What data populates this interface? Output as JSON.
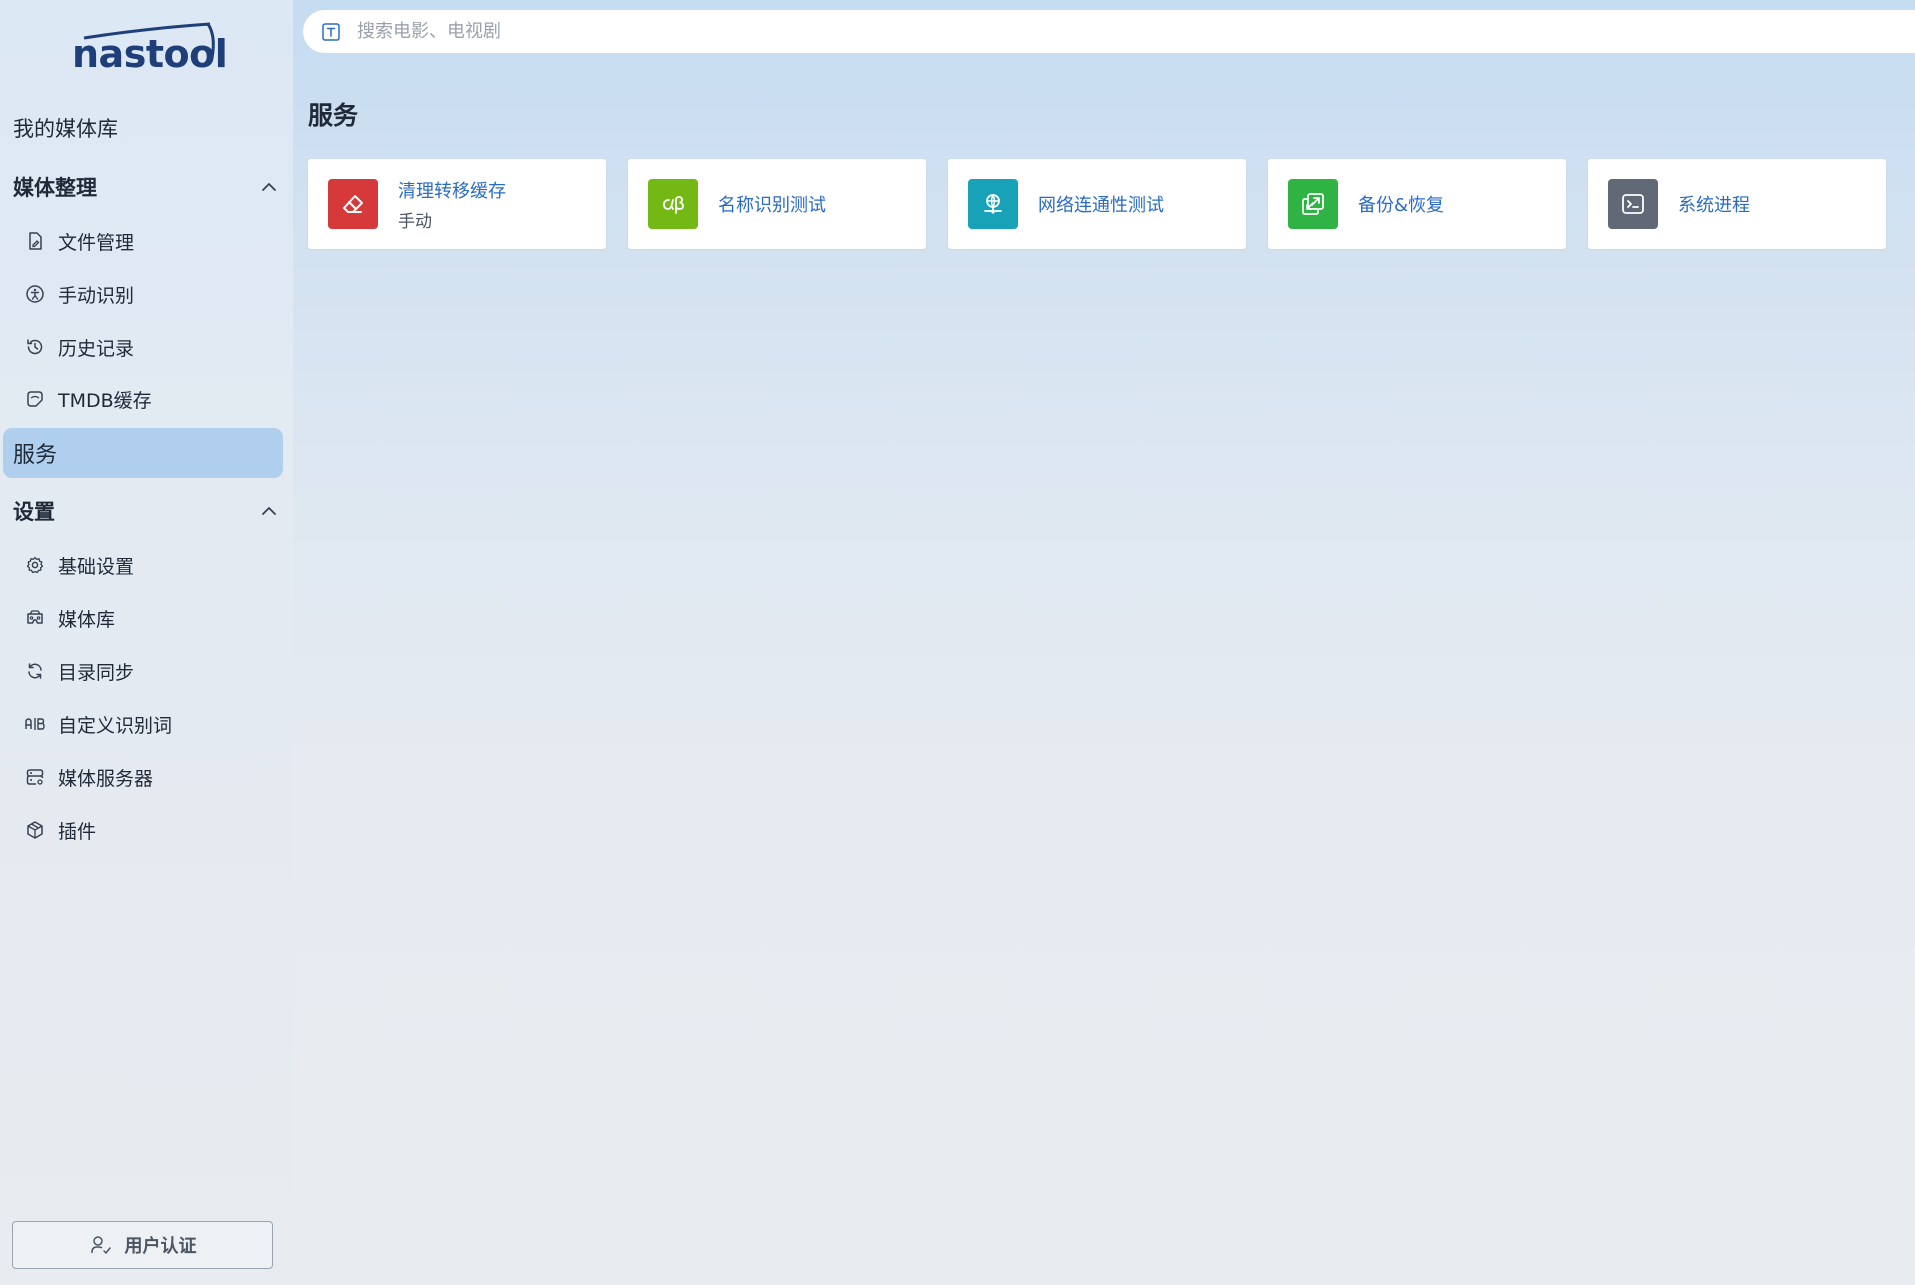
{
  "app": {
    "logo_text": "nastool"
  },
  "sidebar": {
    "top_item": "我的媒体库",
    "group_media": {
      "label": "媒体整理",
      "items": [
        {
          "label": "文件管理",
          "icon": "file-edit-icon"
        },
        {
          "label": "手动识别",
          "icon": "accessibility-icon"
        },
        {
          "label": "历史记录",
          "icon": "history-icon"
        },
        {
          "label": "TMDB缓存",
          "icon": "sticker-icon"
        }
      ]
    },
    "active_item": "服务",
    "group_settings": {
      "label": "设置",
      "items": [
        {
          "label": "基础设置",
          "icon": "gear-icon"
        },
        {
          "label": "媒体库",
          "icon": "cardboard-icon"
        },
        {
          "label": "目录同步",
          "icon": "refresh-icon"
        },
        {
          "label": "自定义识别词",
          "icon": "ab-icon"
        },
        {
          "label": "媒体服务器",
          "icon": "server-icon"
        },
        {
          "label": "插件",
          "icon": "package-icon"
        }
      ]
    },
    "auth_button": "用户认证"
  },
  "search": {
    "placeholder": "搜索电影、电视剧"
  },
  "main": {
    "title": "服务",
    "cards": [
      {
        "name": "清理转移缓存",
        "sub": "手动",
        "icon": "eraser-icon",
        "color": "#d63939"
      },
      {
        "name": "名称识别测试",
        "sub": "",
        "icon": "alpha-beta-icon",
        "color": "#74b816"
      },
      {
        "name": "网络连通性测试",
        "sub": "",
        "icon": "network-icon",
        "color": "#17a2b8"
      },
      {
        "name": "备份&恢复",
        "sub": "",
        "icon": "backup-icon",
        "color": "#2fb344"
      },
      {
        "name": "系统进程",
        "sub": "",
        "icon": "terminal-icon",
        "color": "#616876"
      }
    ]
  }
}
